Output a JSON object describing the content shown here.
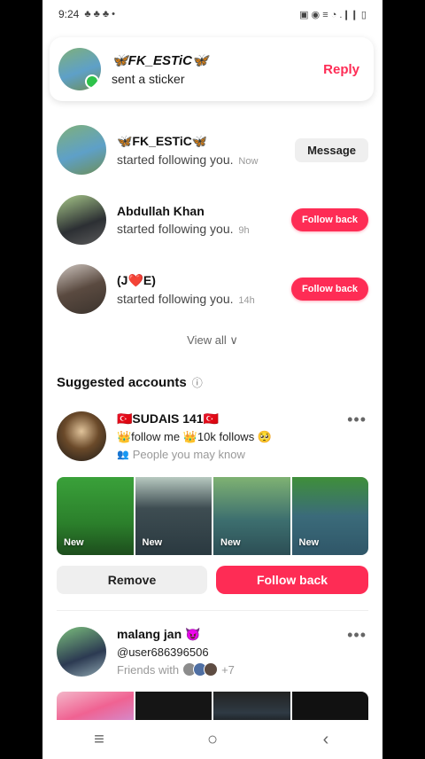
{
  "status_bar": {
    "time": "9:24",
    "left_icons": "♣ ♣ ♣ •",
    "right_icons": "▣ ◉ ≡ ◔ .❙❙ ▯"
  },
  "notification": {
    "name": "🦋FK_ESTiC🦋",
    "message": "sent a sticker",
    "reply_label": "Reply"
  },
  "activity": [
    {
      "name": "🦋FK_ESTiC🦋",
      "text": "started following you.",
      "time": "Now",
      "button": "Message"
    },
    {
      "name": "Abdullah Khan",
      "text": "started following you.",
      "time": "9h",
      "button": "Follow back"
    },
    {
      "name": "(J❤️E)",
      "text": "started following you.",
      "time": "14h",
      "button": "Follow back"
    }
  ],
  "view_all": "View all ∨",
  "suggested": {
    "title": "Suggested accounts",
    "info_icon": "ⓘ",
    "account1": {
      "name": "🇹🇷SUDAIS 141🇹🇷",
      "line2": "👑follow me 👑10k follows 🥺",
      "line3": "People you may know",
      "people_icon": "👥",
      "more": "•••",
      "thumb_label": "New",
      "remove_label": "Remove",
      "follow_label": "Follow back"
    },
    "account2": {
      "name": "malang jan 😈",
      "handle": "@user686396506",
      "friends_text": "Friends with",
      "friends_more": "+7",
      "more": "•••"
    }
  },
  "nav": {
    "menu": "≡",
    "home": "○",
    "back": "‹"
  }
}
